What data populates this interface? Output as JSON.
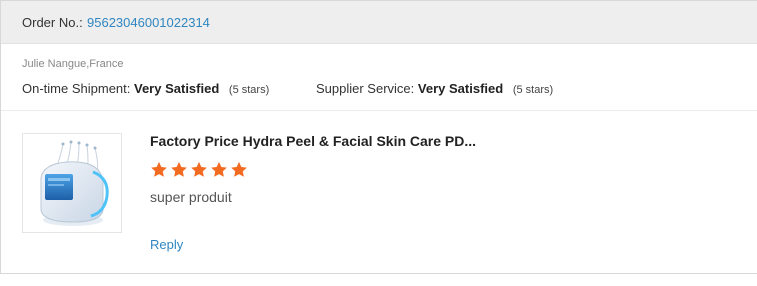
{
  "order": {
    "label": "Order No.:",
    "number": "95623046001022314"
  },
  "buyer": "Julie Nangue,France",
  "ratings": [
    {
      "label": "On-time Shipment:",
      "value": "Very Satisfied",
      "stars_text": "(5 stars)"
    },
    {
      "label": "Supplier Service:",
      "value": "Very Satisfied",
      "stars_text": "(5 stars)"
    }
  ],
  "product": {
    "title": "Factory Price Hydra Peel & Facial Skin Care PD...",
    "image_icon": "beauty-machine-image",
    "star_rating": 5,
    "star_color": "#f26b21"
  },
  "review_text": "super produit",
  "reply_label": "Reply",
  "colors": {
    "link": "#2f86c1",
    "header_bg": "#eeeeee"
  }
}
